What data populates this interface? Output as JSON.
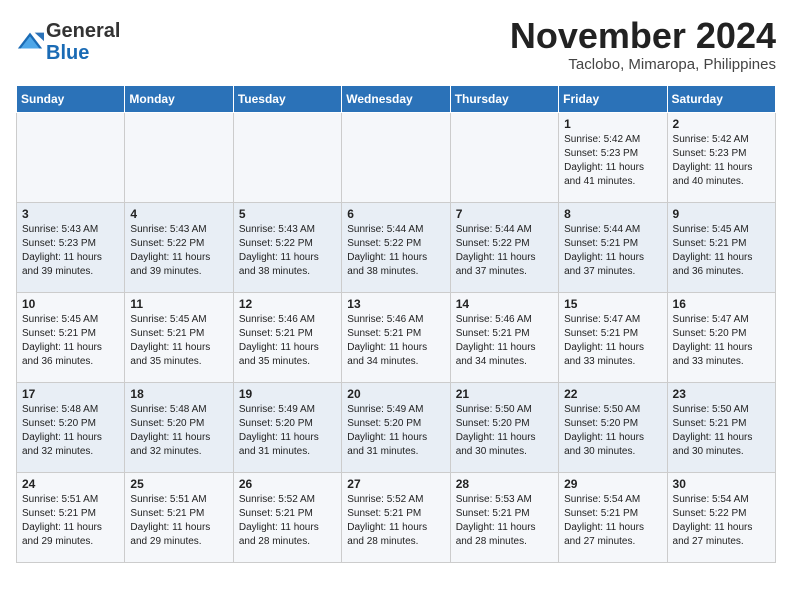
{
  "header": {
    "logo_line1": "General",
    "logo_line2": "Blue",
    "month_title": "November 2024",
    "location": "Taclobo, Mimaropa, Philippines"
  },
  "days_of_week": [
    "Sunday",
    "Monday",
    "Tuesday",
    "Wednesday",
    "Thursday",
    "Friday",
    "Saturday"
  ],
  "weeks": [
    [
      {
        "day": "",
        "info": ""
      },
      {
        "day": "",
        "info": ""
      },
      {
        "day": "",
        "info": ""
      },
      {
        "day": "",
        "info": ""
      },
      {
        "day": "",
        "info": ""
      },
      {
        "day": "1",
        "info": "Sunrise: 5:42 AM\nSunset: 5:23 PM\nDaylight: 11 hours and 41 minutes."
      },
      {
        "day": "2",
        "info": "Sunrise: 5:42 AM\nSunset: 5:23 PM\nDaylight: 11 hours and 40 minutes."
      }
    ],
    [
      {
        "day": "3",
        "info": "Sunrise: 5:43 AM\nSunset: 5:23 PM\nDaylight: 11 hours and 39 minutes."
      },
      {
        "day": "4",
        "info": "Sunrise: 5:43 AM\nSunset: 5:22 PM\nDaylight: 11 hours and 39 minutes."
      },
      {
        "day": "5",
        "info": "Sunrise: 5:43 AM\nSunset: 5:22 PM\nDaylight: 11 hours and 38 minutes."
      },
      {
        "day": "6",
        "info": "Sunrise: 5:44 AM\nSunset: 5:22 PM\nDaylight: 11 hours and 38 minutes."
      },
      {
        "day": "7",
        "info": "Sunrise: 5:44 AM\nSunset: 5:22 PM\nDaylight: 11 hours and 37 minutes."
      },
      {
        "day": "8",
        "info": "Sunrise: 5:44 AM\nSunset: 5:21 PM\nDaylight: 11 hours and 37 minutes."
      },
      {
        "day": "9",
        "info": "Sunrise: 5:45 AM\nSunset: 5:21 PM\nDaylight: 11 hours and 36 minutes."
      }
    ],
    [
      {
        "day": "10",
        "info": "Sunrise: 5:45 AM\nSunset: 5:21 PM\nDaylight: 11 hours and 36 minutes."
      },
      {
        "day": "11",
        "info": "Sunrise: 5:45 AM\nSunset: 5:21 PM\nDaylight: 11 hours and 35 minutes."
      },
      {
        "day": "12",
        "info": "Sunrise: 5:46 AM\nSunset: 5:21 PM\nDaylight: 11 hours and 35 minutes."
      },
      {
        "day": "13",
        "info": "Sunrise: 5:46 AM\nSunset: 5:21 PM\nDaylight: 11 hours and 34 minutes."
      },
      {
        "day": "14",
        "info": "Sunrise: 5:46 AM\nSunset: 5:21 PM\nDaylight: 11 hours and 34 minutes."
      },
      {
        "day": "15",
        "info": "Sunrise: 5:47 AM\nSunset: 5:21 PM\nDaylight: 11 hours and 33 minutes."
      },
      {
        "day": "16",
        "info": "Sunrise: 5:47 AM\nSunset: 5:20 PM\nDaylight: 11 hours and 33 minutes."
      }
    ],
    [
      {
        "day": "17",
        "info": "Sunrise: 5:48 AM\nSunset: 5:20 PM\nDaylight: 11 hours and 32 minutes."
      },
      {
        "day": "18",
        "info": "Sunrise: 5:48 AM\nSunset: 5:20 PM\nDaylight: 11 hours and 32 minutes."
      },
      {
        "day": "19",
        "info": "Sunrise: 5:49 AM\nSunset: 5:20 PM\nDaylight: 11 hours and 31 minutes."
      },
      {
        "day": "20",
        "info": "Sunrise: 5:49 AM\nSunset: 5:20 PM\nDaylight: 11 hours and 31 minutes."
      },
      {
        "day": "21",
        "info": "Sunrise: 5:50 AM\nSunset: 5:20 PM\nDaylight: 11 hours and 30 minutes."
      },
      {
        "day": "22",
        "info": "Sunrise: 5:50 AM\nSunset: 5:20 PM\nDaylight: 11 hours and 30 minutes."
      },
      {
        "day": "23",
        "info": "Sunrise: 5:50 AM\nSunset: 5:21 PM\nDaylight: 11 hours and 30 minutes."
      }
    ],
    [
      {
        "day": "24",
        "info": "Sunrise: 5:51 AM\nSunset: 5:21 PM\nDaylight: 11 hours and 29 minutes."
      },
      {
        "day": "25",
        "info": "Sunrise: 5:51 AM\nSunset: 5:21 PM\nDaylight: 11 hours and 29 minutes."
      },
      {
        "day": "26",
        "info": "Sunrise: 5:52 AM\nSunset: 5:21 PM\nDaylight: 11 hours and 28 minutes."
      },
      {
        "day": "27",
        "info": "Sunrise: 5:52 AM\nSunset: 5:21 PM\nDaylight: 11 hours and 28 minutes."
      },
      {
        "day": "28",
        "info": "Sunrise: 5:53 AM\nSunset: 5:21 PM\nDaylight: 11 hours and 28 minutes."
      },
      {
        "day": "29",
        "info": "Sunrise: 5:54 AM\nSunset: 5:21 PM\nDaylight: 11 hours and 27 minutes."
      },
      {
        "day": "30",
        "info": "Sunrise: 5:54 AM\nSunset: 5:22 PM\nDaylight: 11 hours and 27 minutes."
      }
    ]
  ]
}
